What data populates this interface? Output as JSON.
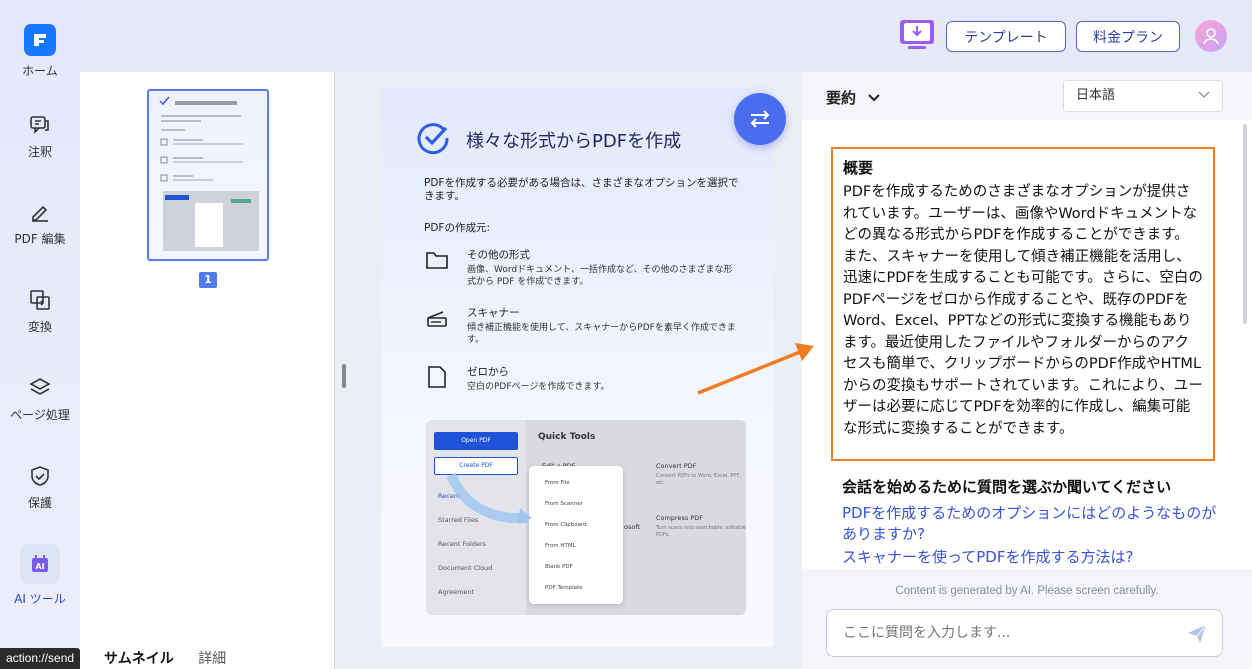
{
  "rail": {
    "home": "ホーム",
    "annotate": "注釈",
    "edit": "PDF 編集",
    "convert": "変換",
    "page": "ページ処理",
    "protect": "保護",
    "ai": "AI ツール"
  },
  "topbar": {
    "template_label": "テンプレート",
    "pricing_label": "料金プラン"
  },
  "thumbnails": {
    "page_number": "1",
    "tab_thumbnail": "サムネイル",
    "tab_detail": "詳細"
  },
  "document": {
    "title": "様々な形式からPDFを作成",
    "intro": "PDFを作成する必要がある場合は、さまざまなオプションを選択できます。",
    "sources_heading": "PDFの作成元:",
    "options": [
      {
        "title": "その他の形式",
        "desc": "画像、Wordドキュメント、一括作成など、その他のさまざまな形式から PDF を作成できます。"
      },
      {
        "title": "スキャナー",
        "desc": "傾き補正機能を使用して、スキャナーからPDFを素早く作成できます。"
      },
      {
        "title": "ゼロから",
        "desc": "空白のPDFページを作成できます。"
      }
    ],
    "mock": {
      "open_pdf": "Open PDF",
      "create_pdf": "Create PDF",
      "nav": [
        "Recent",
        "Starred Files",
        "Recent Folders",
        "Document Cloud",
        "Agreement"
      ],
      "quick_tools": "Quick Tools",
      "card1_title": "Convert PDF",
      "card1_desc": "Convert PDFs to Word, Excel, PPT, etc.",
      "card2_title": "Compress PDF",
      "card2_desc": "Turn scans into searchable, editable PDFs.",
      "edit_label": "Edit a PDF",
      "soft_label": "osoft",
      "menu": [
        "From File",
        "From Scanner",
        "From Clipboard",
        "From HTML",
        "Blank PDF",
        "PDF Template"
      ]
    }
  },
  "ai_panel": {
    "mode_label": "要約",
    "language": "日本語",
    "summary_heading": "概要",
    "summary_text": "PDFを作成するためのさまざまなオプションが提供されています。ユーザーは、画像やWordドキュメントなどの異なる形式からPDFを作成することができます。また、スキャナーを使用して傾き補正機能を活用し、迅速にPDFを生成することも可能です。さらに、空白のPDFページをゼロから作成することや、既存のPDFをWord、Excel、PPTなどの形式に変換する機能もあります。最近使用したファイルやフォルダーからのアクセスも簡単で、クリップボードからのPDF作成やHTMLからの変換もサポートされています。これにより、ユーザーは必要に応じてPDFを効率的に作成し、編集可能な形式に変換することができます。",
    "questions_heading": "会話を始めるために質問を選ぶか聞いてください",
    "questions": [
      "PDFを作成するためのオプションにはどのようなものがありますか?",
      "スキャナーを使ってPDFを作成する方法は?"
    ],
    "disclaimer": "Content is generated by AI. Please screen carefully.",
    "input_placeholder": "ここに質問を入力します..."
  },
  "status_bar": "action://send",
  "colors": {
    "accent": "#4a6cf0",
    "highlight_border": "#f07c24",
    "link": "#3653d6"
  }
}
